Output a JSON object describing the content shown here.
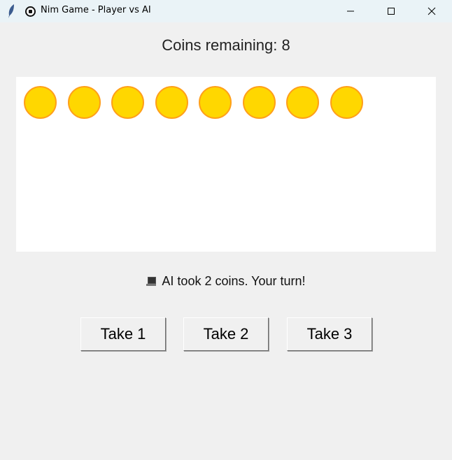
{
  "window": {
    "title": "Nim Game - Player vs AI"
  },
  "heading": "Coins remaining: 8",
  "coins": {
    "count": 8,
    "fill": "#ffd700",
    "stroke": "#ff9f1a"
  },
  "status": {
    "icon": "computer-icon",
    "text": "AI took 2 coins. Your turn!"
  },
  "buttons": [
    {
      "label": "Take 1"
    },
    {
      "label": "Take 2"
    },
    {
      "label": "Take 3"
    }
  ]
}
